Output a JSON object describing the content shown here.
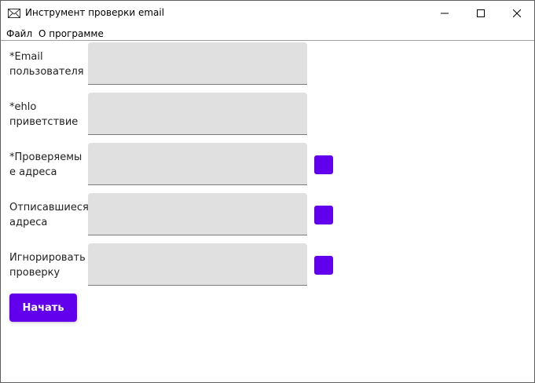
{
  "window": {
    "title": "Инструмент проверки email",
    "icon": "envelope-icon",
    "controls": [
      "minimize-icon",
      "maximize-icon",
      "close-icon"
    ]
  },
  "menu": {
    "file": "Файл",
    "about": "О программе"
  },
  "form": {
    "email": {
      "label_line1": "*Email",
      "label_line2": "пользователя",
      "value": ""
    },
    "ehlo": {
      "label_line1": "*ehlo",
      "label_line2": "приветствие",
      "value": ""
    },
    "checked": {
      "label_line1": "*Проверяемы",
      "label_line2": "е адреса",
      "value": ""
    },
    "unsubscribed": {
      "label_line1": "Отписавшиеся",
      "label_line2": "адреса",
      "value": ""
    },
    "ignore": {
      "label_line1": "Игнорировать",
      "label_line2": "проверку",
      "value": ""
    }
  },
  "start_button": "Начать",
  "colors": {
    "accent": "#6200ee",
    "field_bg": "#e0e0e0"
  }
}
